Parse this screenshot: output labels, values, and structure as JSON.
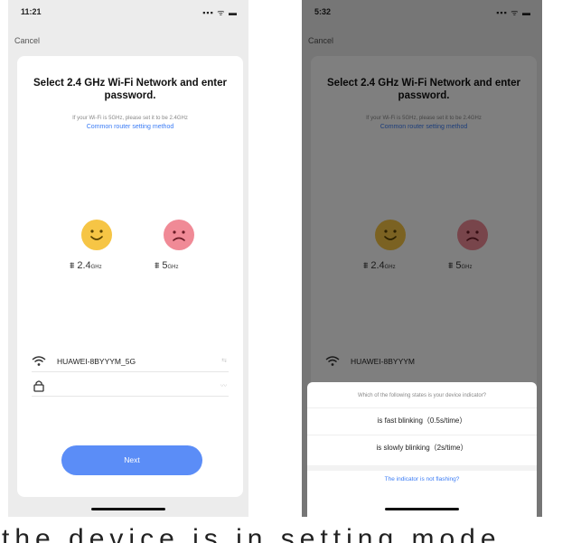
{
  "left_screen": {
    "status_time": "11:21",
    "status_icons": "▪▪▪ ᯤ ▬",
    "cancel_label": "Cancel",
    "title": "Select 2.4 GHz Wi-Fi Network and enter password.",
    "hint": "If your Wi-Fi is 5GHz, please set it to be 2.4GHz",
    "router_link": "Common router setting method",
    "band_good": {
      "value": "2.4",
      "unit": "GHz"
    },
    "band_bad": {
      "value": "5",
      "unit": "GHz"
    },
    "wifi_name": "HUAWEI-8BYYYM_5G",
    "wifi_tail": "⇆",
    "password_tail": "〰",
    "next_label": "Next",
    "colors": {
      "smile": "#f6c545",
      "sad": "#f08a96",
      "accent": "#5b8df7",
      "link": "#3b7cf5"
    },
    "icons": [
      "wifi-icon",
      "lock-icon",
      "smile-face-icon",
      "sad-face-icon",
      "router-icon"
    ]
  },
  "right_screen": {
    "status_time": "5:32",
    "status_icons": "▪▪▪ ᯤ ▬",
    "cancel_label": "Cancel",
    "title": "Select 2.4 GHz Wi-Fi Network and enter password.",
    "hint": "If your Wi-Fi is 5GHz, please set it to be 2.4GHz",
    "router_link": "Common router setting method",
    "band_good": {
      "value": "2.4",
      "unit": "GHz"
    },
    "band_bad": {
      "value": "5",
      "unit": "GHz"
    },
    "wifi_name": "HUAWEI-8BYYYM",
    "sheet": {
      "question": "Which of the following states is your device indicator?",
      "option_fast": "is fast blinking（0.5s/time）",
      "option_slow": "is slowly blinking（2s/time）",
      "not_flashing_link": "The indicator is not flashing?"
    }
  },
  "caption_text": "the device is in setting mode"
}
